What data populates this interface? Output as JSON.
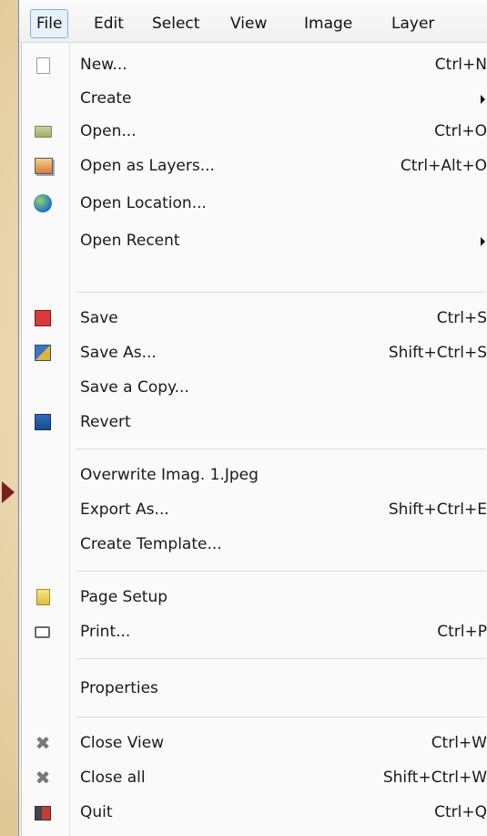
{
  "menubar": {
    "items": [
      {
        "label": "File"
      },
      {
        "label": "Edit"
      },
      {
        "label": "Select"
      },
      {
        "label": "View"
      },
      {
        "label": "Image"
      },
      {
        "label": "Layer"
      }
    ]
  },
  "file_menu": {
    "items": [
      {
        "label": "New...",
        "shortcut": "Ctrl+N",
        "icon": "new-document-icon"
      },
      {
        "label": "Create",
        "shortcut": "",
        "icon": "",
        "submenu": true
      },
      {
        "label": "Open...",
        "shortcut": "Ctrl+O",
        "icon": "folder-open-icon"
      },
      {
        "label": "Open as Layers...",
        "shortcut": "Ctrl+Alt+O",
        "icon": "open-layers-icon"
      },
      {
        "label": "Open Location...",
        "shortcut": "",
        "icon": "globe-icon"
      },
      {
        "label": "Open Recent",
        "shortcut": "",
        "icon": "",
        "submenu": true
      },
      {
        "label": "Save",
        "shortcut": "Ctrl+S",
        "icon": "save-icon"
      },
      {
        "label": "Save As...",
        "shortcut": "Shift+Ctrl+S",
        "icon": "save-as-icon"
      },
      {
        "label": "Save a Copy...",
        "shortcut": "",
        "icon": ""
      },
      {
        "label": "Revert",
        "shortcut": "",
        "icon": "revert-icon"
      },
      {
        "label": "Overwrite Imag. 1.Jpeg",
        "shortcut": "",
        "icon": ""
      },
      {
        "label": "Export As...",
        "shortcut": "Shift+Ctrl+E",
        "icon": ""
      },
      {
        "label": "Create Template...",
        "shortcut": "",
        "icon": ""
      },
      {
        "label": "Page Setup",
        "shortcut": "",
        "icon": "page-setup-icon"
      },
      {
        "label": "Print...",
        "shortcut": "Ctrl+P",
        "icon": "printer-icon"
      },
      {
        "label": "Properties",
        "shortcut": "",
        "icon": ""
      },
      {
        "label": "Close View",
        "shortcut": "Ctrl+W",
        "icon": "close-icon"
      },
      {
        "label": "Close all",
        "shortcut": "Shift+Ctrl+W",
        "icon": "close-icon"
      },
      {
        "label": "Quit",
        "shortcut": "Ctrl+Q",
        "icon": "quit-icon"
      }
    ]
  }
}
